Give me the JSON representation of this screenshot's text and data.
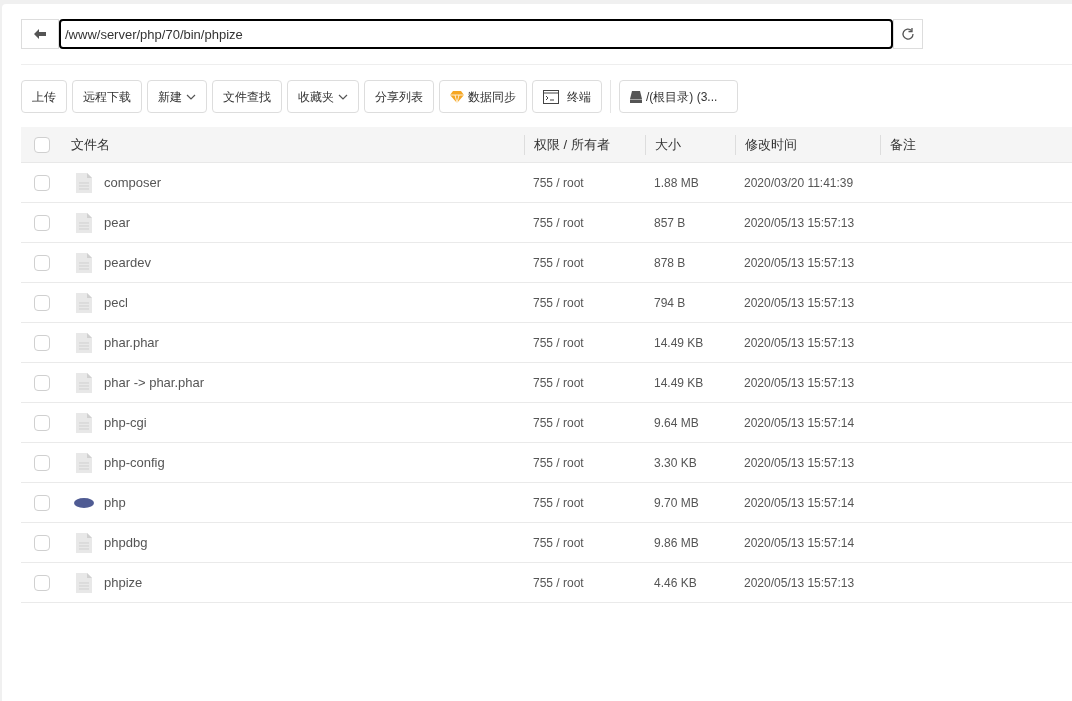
{
  "path_bar": {
    "value": "/www/server/php/70/bin/phpize"
  },
  "toolbar": [
    {
      "label": "上传",
      "kind": "plain"
    },
    {
      "label": "远程下载",
      "kind": "plain"
    },
    {
      "label": "新建",
      "kind": "dropdown"
    },
    {
      "label": "文件查找",
      "kind": "plain"
    },
    {
      "label": "收藏夹",
      "kind": "dropdown"
    },
    {
      "label": "分享列表",
      "kind": "plain"
    },
    {
      "label": "数据同步",
      "kind": "sync"
    },
    {
      "label": "终端",
      "kind": "terminal"
    },
    {
      "label": "/(根目录) (3...",
      "kind": "disk"
    }
  ],
  "table": {
    "select_all_checked": false,
    "columns": [
      "文件名",
      "权限 / 所有者",
      "大小",
      "修改时间",
      "备注"
    ],
    "rows": [
      {
        "name": "composer",
        "kind": "file",
        "checked": false,
        "perm": "755 / root",
        "size": "1.88 MB",
        "mtime": "2020/03/20 11:41:39"
      },
      {
        "name": "pear",
        "kind": "file",
        "checked": false,
        "perm": "755 / root",
        "size": "857 B",
        "mtime": "2020/05/13 15:57:13"
      },
      {
        "name": "peardev",
        "kind": "file",
        "checked": false,
        "perm": "755 / root",
        "size": "878 B",
        "mtime": "2020/05/13 15:57:13"
      },
      {
        "name": "pecl",
        "kind": "file",
        "checked": false,
        "perm": "755 / root",
        "size": "794 B",
        "mtime": "2020/05/13 15:57:13"
      },
      {
        "name": "phar.phar",
        "kind": "file",
        "checked": false,
        "perm": "755 / root",
        "size": "14.49 KB",
        "mtime": "2020/05/13 15:57:13"
      },
      {
        "name": "phar -> phar.phar",
        "kind": "file",
        "checked": false,
        "perm": "755 / root",
        "size": "14.49 KB",
        "mtime": "2020/05/13 15:57:13"
      },
      {
        "name": "php-cgi",
        "kind": "file",
        "checked": false,
        "perm": "755 / root",
        "size": "9.64 MB",
        "mtime": "2020/05/13 15:57:14"
      },
      {
        "name": "php-config",
        "kind": "file",
        "checked": false,
        "perm": "755 / root",
        "size": "3.30 KB",
        "mtime": "2020/05/13 15:57:13"
      },
      {
        "name": "php",
        "kind": "php",
        "checked": false,
        "perm": "755 / root",
        "size": "9.70 MB",
        "mtime": "2020/05/13 15:57:14"
      },
      {
        "name": "phpdbg",
        "kind": "file",
        "checked": false,
        "perm": "755 / root",
        "size": "9.86 MB",
        "mtime": "2020/05/13 15:57:14"
      },
      {
        "name": "phpize",
        "kind": "file",
        "checked": false,
        "perm": "755 / root",
        "size": "4.46 KB",
        "mtime": "2020/05/13 15:57:13"
      }
    ]
  }
}
